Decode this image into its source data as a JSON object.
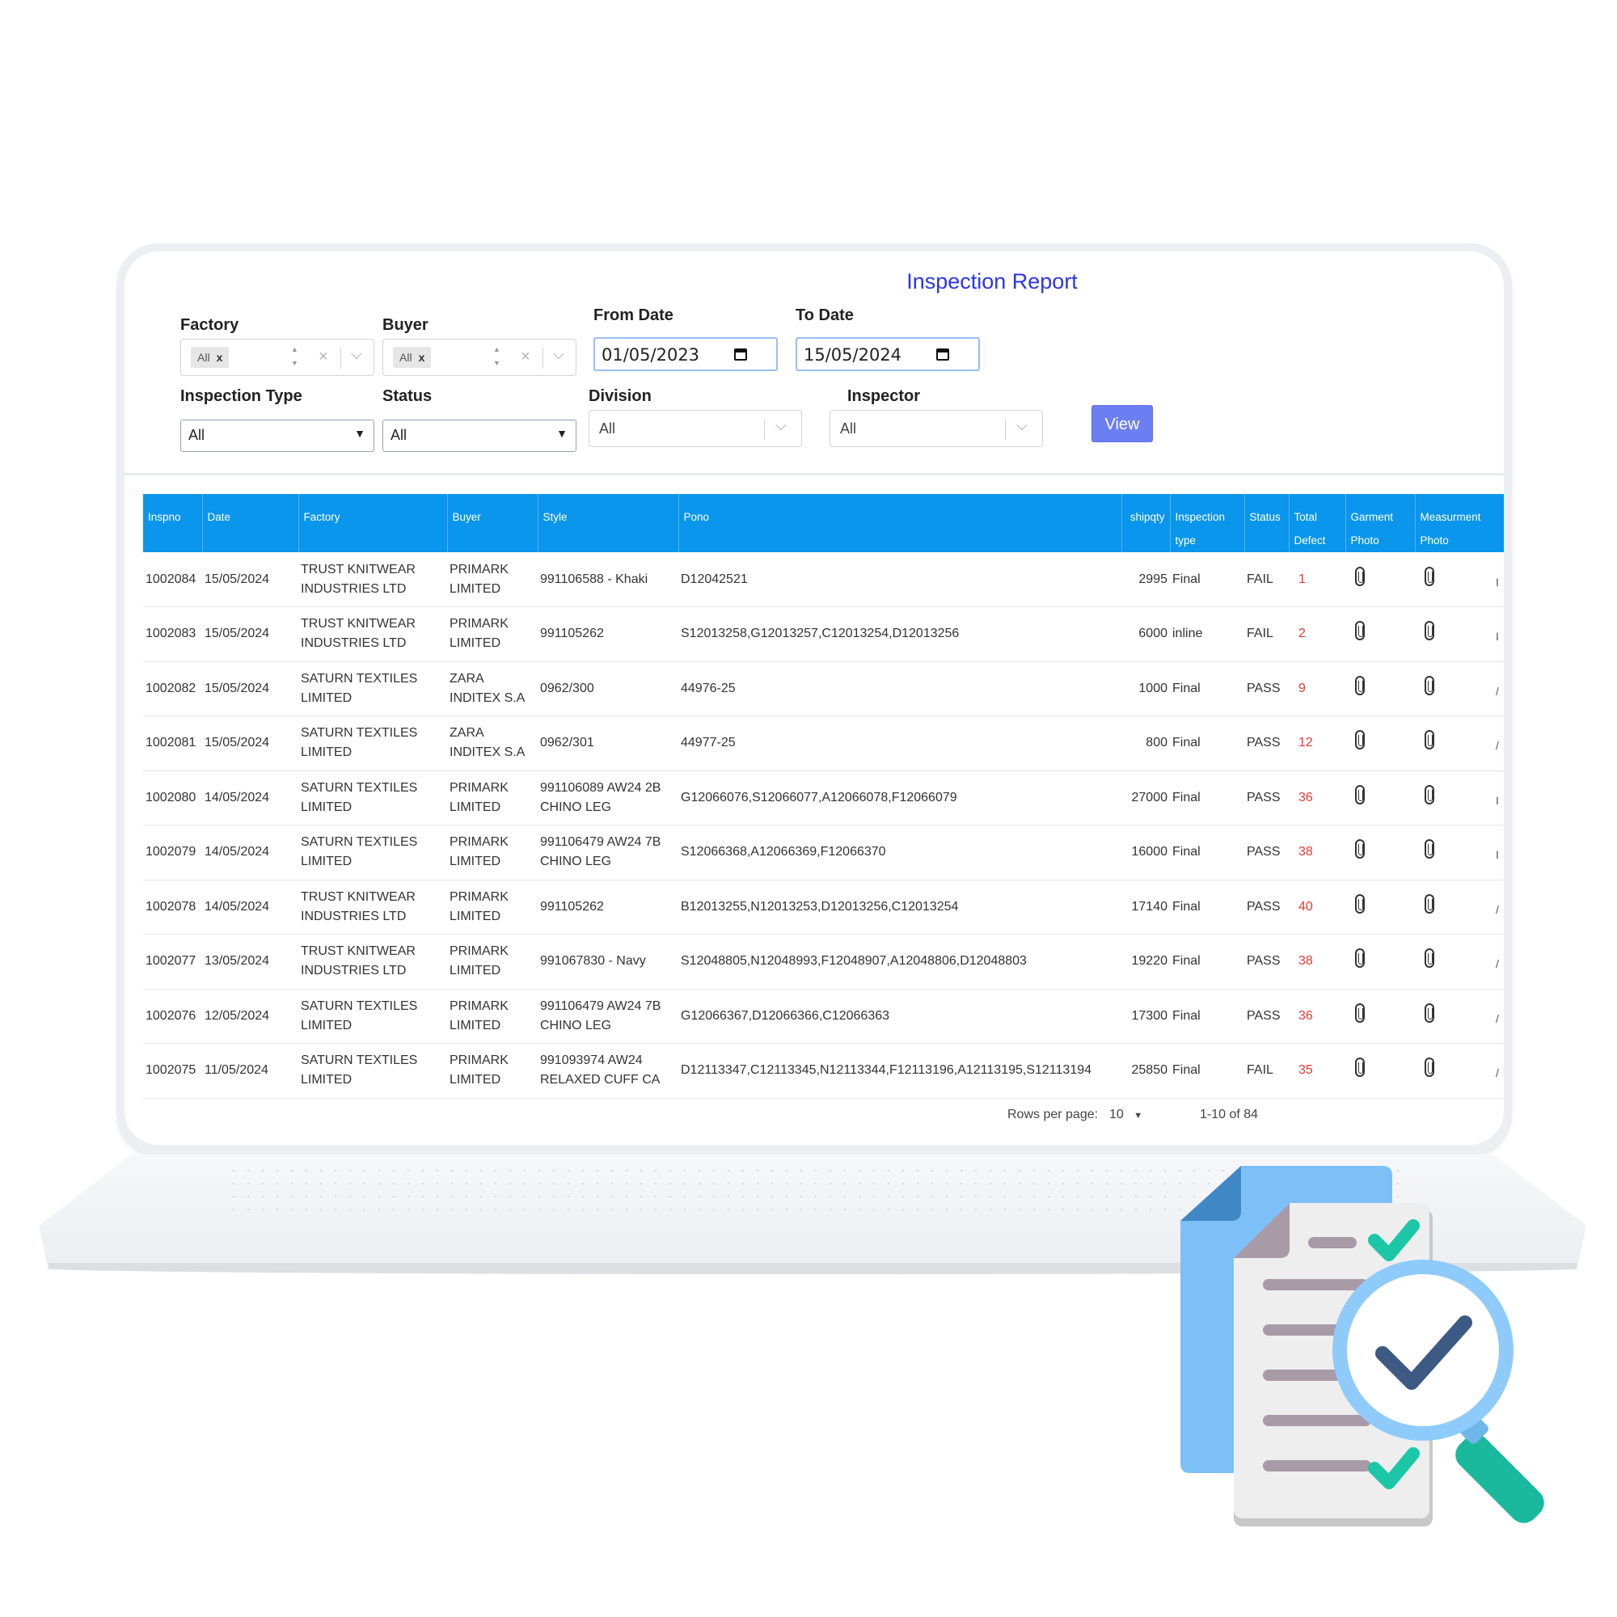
{
  "report": {
    "title": "Inspection Report"
  },
  "filters": {
    "factory": {
      "label": "Factory",
      "chip": "All",
      "chip_remove": "x"
    },
    "buyer": {
      "label": "Buyer",
      "chip": "All",
      "chip_remove": "x"
    },
    "from_date": {
      "label": "From Date",
      "value": "01/05/2023"
    },
    "to_date": {
      "label": "To Date",
      "value": "15/05/2024"
    },
    "inspection_type": {
      "label": "Inspection Type",
      "value": "All"
    },
    "status": {
      "label": "Status",
      "value": "All"
    },
    "division": {
      "label": "Division",
      "value": "All"
    },
    "inspector": {
      "label": "Inspector",
      "value": "All"
    },
    "view_label": "View"
  },
  "table": {
    "headers": {
      "inspno": "Inspno",
      "date": "Date",
      "factory": "Factory",
      "buyer": "Buyer",
      "style": "Style",
      "pono": "Pono",
      "shipqty": "shipqty",
      "inspection_type_1": "Inspection",
      "inspection_type_2": "type",
      "status": "Status",
      "total_defect_1": "Total",
      "total_defect_2": "Defect",
      "garment_photo_1": "Garment",
      "garment_photo_2": "Photo",
      "measurement_photo_1": "Measurment",
      "measurement_photo_2": "Photo"
    },
    "rows": [
      {
        "inspno": "1002084",
        "date": "15/05/2024",
        "factory": "TRUST KNITWEAR INDUSTRIES LTD",
        "buyer": "PRIMARK LIMITED",
        "style": "991106588 - Khaki",
        "pono": "D12042521",
        "shipqty": "2995",
        "type": "Final",
        "status": "FAIL",
        "defect": "1",
        "cut": "I"
      },
      {
        "inspno": "1002083",
        "date": "15/05/2024",
        "factory": "TRUST KNITWEAR INDUSTRIES LTD",
        "buyer": "PRIMARK LIMITED",
        "style": "991105262",
        "pono": "S12013258,G12013257,C12013254,D12013256",
        "shipqty": "6000",
        "type": "inline",
        "status": "FAIL",
        "defect": "2",
        "cut": "I"
      },
      {
        "inspno": "1002082",
        "date": "15/05/2024",
        "factory": "SATURN TEXTILES LIMITED",
        "buyer": "ZARA INDITEX S.A",
        "style": "0962/300",
        "pono": "44976-25",
        "shipqty": "1000",
        "type": "Final",
        "status": "PASS",
        "defect": "9",
        "cut": "/"
      },
      {
        "inspno": "1002081",
        "date": "15/05/2024",
        "factory": "SATURN TEXTILES LIMITED",
        "buyer": "ZARA INDITEX S.A",
        "style": "0962/301",
        "pono": "44977-25",
        "shipqty": "800",
        "type": "Final",
        "status": "PASS",
        "defect": "12",
        "cut": "/"
      },
      {
        "inspno": "1002080",
        "date": "14/05/2024",
        "factory": "SATURN TEXTILES LIMITED",
        "buyer": "PRIMARK LIMITED",
        "style": "991106089 AW24 2B CHINO LEG",
        "pono": "G12066076,S12066077,A12066078,F12066079",
        "shipqty": "27000",
        "type": "Final",
        "status": "PASS",
        "defect": "36",
        "cut": "I"
      },
      {
        "inspno": "1002079",
        "date": "14/05/2024",
        "factory": "SATURN TEXTILES LIMITED",
        "buyer": "PRIMARK LIMITED",
        "style": "991106479 AW24 7B CHINO LEG",
        "pono": "S12066368,A12066369,F12066370",
        "shipqty": "16000",
        "type": "Final",
        "status": "PASS",
        "defect": "38",
        "cut": "I"
      },
      {
        "inspno": "1002078",
        "date": "14/05/2024",
        "factory": "TRUST KNITWEAR INDUSTRIES LTD",
        "buyer": "PRIMARK LIMITED",
        "style": "991105262",
        "pono": "B12013255,N12013253,D12013256,C12013254",
        "shipqty": "17140",
        "type": "Final",
        "status": "PASS",
        "defect": "40",
        "cut": "/"
      },
      {
        "inspno": "1002077",
        "date": "13/05/2024",
        "factory": "TRUST KNITWEAR INDUSTRIES LTD",
        "buyer": "PRIMARK LIMITED",
        "style": "991067830 - Navy",
        "pono": "S12048805,N12048993,F12048907,A12048806,D12048803",
        "shipqty": "19220",
        "type": "Final",
        "status": "PASS",
        "defect": "38",
        "cut": "/"
      },
      {
        "inspno": "1002076",
        "date": "12/05/2024",
        "factory": "SATURN TEXTILES LIMITED",
        "buyer": "PRIMARK LIMITED",
        "style": "991106479 AW24 7B CHINO LEG",
        "pono": "G12066367,D12066366,C12066363",
        "shipqty": "17300",
        "type": "Final",
        "status": "PASS",
        "defect": "36",
        "cut": "/"
      },
      {
        "inspno": "1002075",
        "date": "11/05/2024",
        "factory": "SATURN TEXTILES LIMITED",
        "buyer": "PRIMARK LIMITED",
        "style": "991093974 AW24 RELAXED CUFF CA",
        "pono": "D12113347,C12113345,N12113344,F12113196,A12113195,S12113194",
        "shipqty": "25850",
        "type": "Final",
        "status": "FAIL",
        "defect": "35",
        "cut": "/"
      }
    ]
  },
  "pagination": {
    "rows_per_page_label": "Rows per page:",
    "rows_per_page": "10",
    "range": "1-10 of 84"
  },
  "colors": {
    "header_bg": "#0996ec",
    "title": "#2c36e6",
    "view_button": "#6c7ff2",
    "defect_text": "#e53935",
    "doc_blue": "#7dc0f8",
    "check_teal": "#1cc7a8",
    "magnifier_ring": "#8ecbfa"
  },
  "icons": [
    "chip-remove-icon",
    "clear-icon",
    "chevron-down-icon",
    "calendar-icon",
    "attachment-icon",
    "document-checklist-icon",
    "magnifier-check-icon"
  ]
}
